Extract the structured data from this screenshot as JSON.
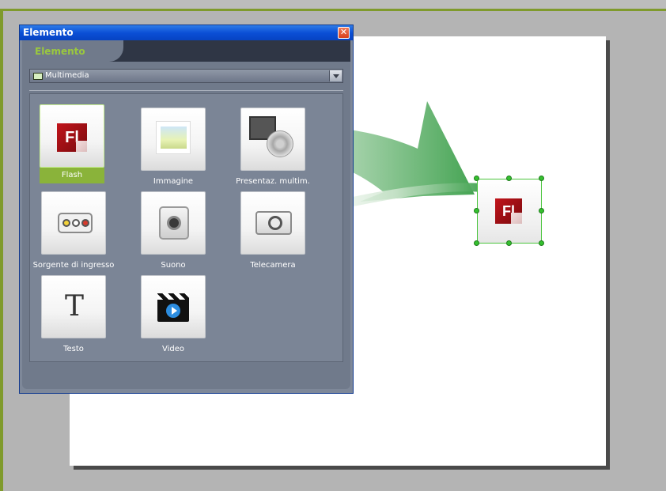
{
  "panel": {
    "title": "Elemento",
    "close_glyph": "✕",
    "tab_label": "Elemento",
    "category": {
      "selected": "Multimedia",
      "icon": "folder-icon"
    },
    "items": [
      {
        "label": "Flash",
        "icon": "flash-icon",
        "selected": true
      },
      {
        "label": "Immagine",
        "icon": "image-icon",
        "selected": false
      },
      {
        "label": "Presentaz. multim.",
        "icon": "multimedia-presentation-icon",
        "selected": false
      },
      {
        "label": "Sorgente di ingresso",
        "icon": "input-source-icon",
        "selected": false
      },
      {
        "label": "Suono",
        "icon": "speaker-icon",
        "selected": false
      },
      {
        "label": "Telecamera",
        "icon": "camera-icon",
        "selected": false
      },
      {
        "label": "Testo",
        "icon": "text-icon",
        "selected": false
      },
      {
        "label": "Video",
        "icon": "video-icon",
        "selected": false
      }
    ]
  },
  "placed_element": {
    "label": "Fl",
    "icon": "flash-icon"
  },
  "glyphs": {
    "flash": "Fl",
    "text": "T"
  },
  "colors": {
    "accent_green": "#8ab33a",
    "frame_green": "#7f9a2c",
    "title_blue": "#0b4fd6",
    "selection_green": "#35c02f",
    "arrow_green": "#3b9f4a"
  }
}
